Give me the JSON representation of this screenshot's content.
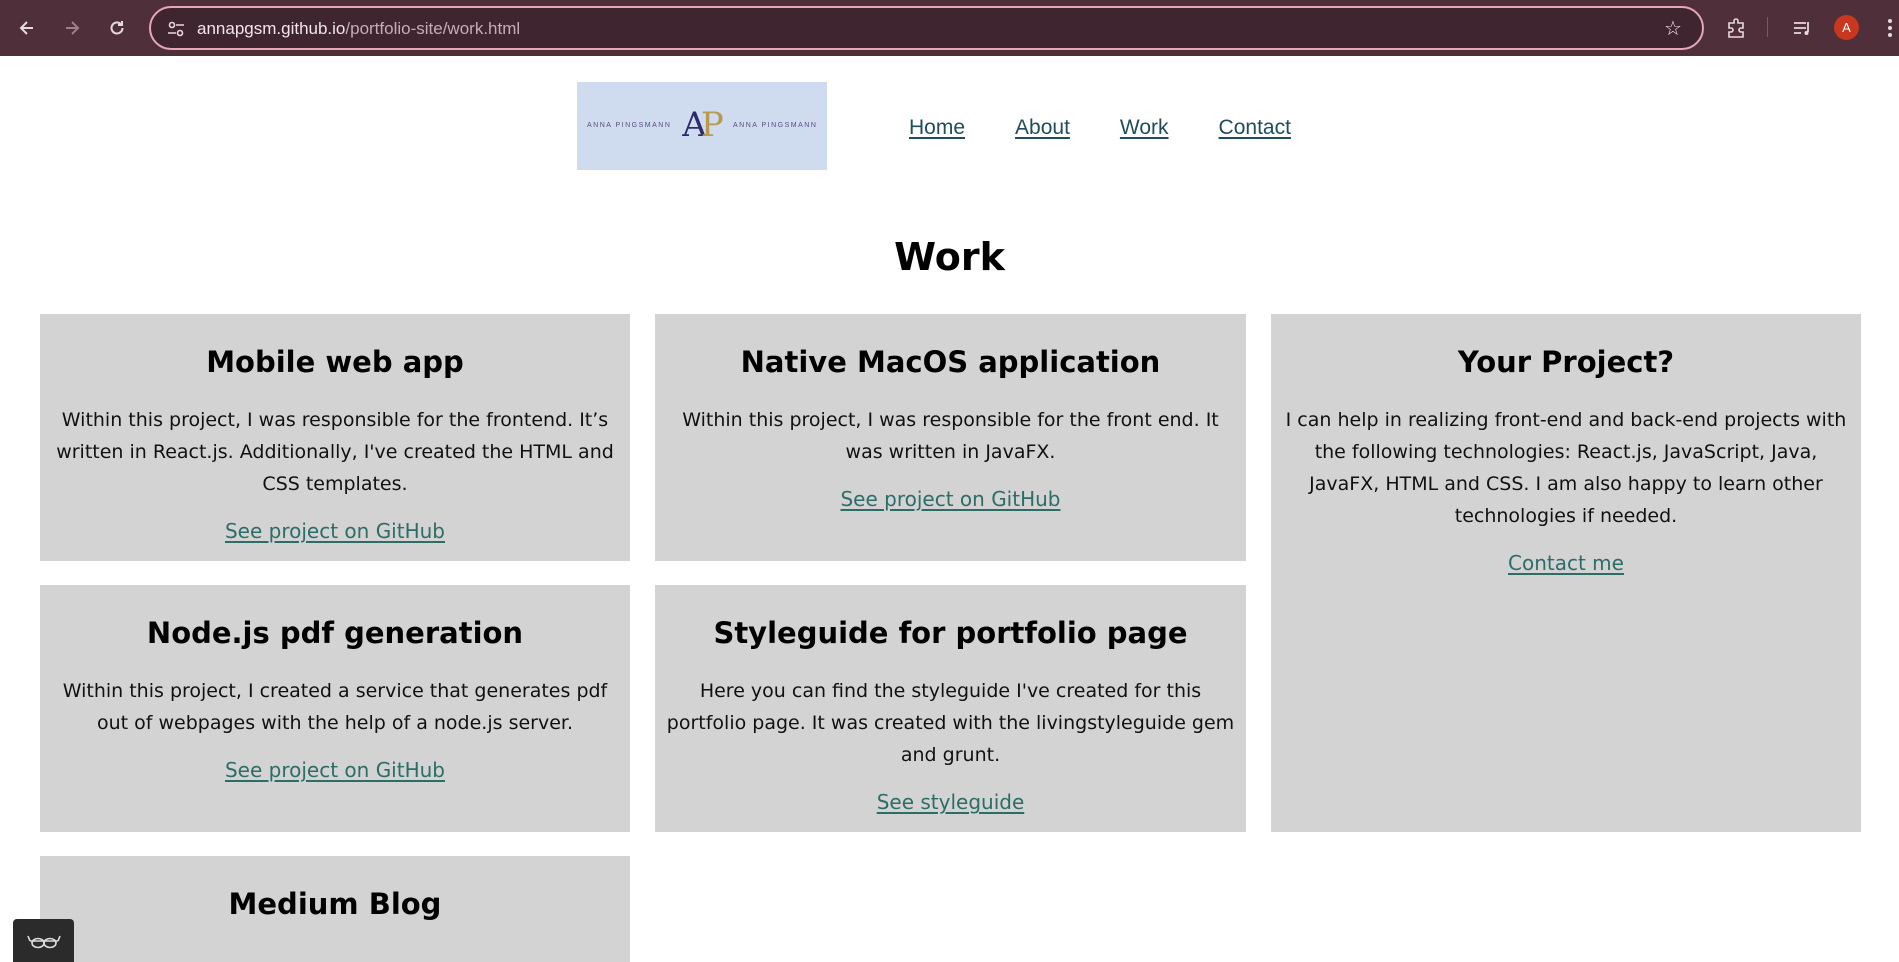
{
  "browser": {
    "url_host": "annapgsm.github.io",
    "url_path": "/portfolio-site/work.html",
    "avatar_letter": "A",
    "icons": [
      "back-icon",
      "forward-icon",
      "reload-icon",
      "site-info-icon",
      "star-icon",
      "extensions-icon",
      "media-icon",
      "menu-icon"
    ]
  },
  "header": {
    "logo_left_text": "ANNA PINGSMANN",
    "logo_right_text": "ANNA PINGSMANN",
    "logo_monogram_a": "A",
    "logo_monogram_p": "P",
    "nav": [
      "Home",
      "About",
      "Work",
      "Contact"
    ]
  },
  "main": {
    "title": "Work",
    "cards": [
      {
        "title": "Mobile web app",
        "text": "Within this project, I was responsible for the frontend. It’s written in React.js. Additionally, I've created the HTML and CSS templates.",
        "link": "See project on GitHub"
      },
      {
        "title": "Native MacOS application",
        "text": "Within this project, I was responsible for the front end. It was written in JavaFX.",
        "link": "See project on GitHub"
      },
      {
        "title": "Your Project?",
        "text": "I can help in realizing front-end and back-end projects with the following technologies: React.js, JavaScript, Java, JavaFX, HTML and CSS. I am also happy to learn other technologies if needed.",
        "link": "Contact me"
      },
      {
        "title": "Node.js pdf generation",
        "text": "Within this project, I created a service that generates pdf out of webpages with the help of a node.js server.",
        "link": "See project on GitHub"
      },
      {
        "title": "Styleguide for portfolio page",
        "text": "Here you can find the styleguide I've created for this portfolio page. It was created with the livingstyleguide gem and grunt.",
        "link": "See styleguide"
      },
      {
        "title": "Medium Blog"
      }
    ]
  },
  "colors": {
    "chrome_bg": "#4f2f39",
    "omnibox_border": "#e7a7b9",
    "card_bg": "#d3d3d3",
    "link": "#2c6d68",
    "nav_link": "#1f4d5c",
    "logo_bg": "#cfdcf0",
    "avatar_bg": "#c8371e"
  }
}
